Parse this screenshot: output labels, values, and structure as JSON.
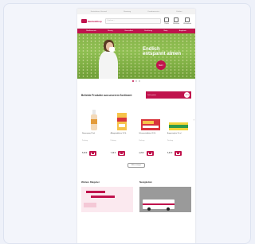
{
  "topstrip": [
    "Kostenloser Versand",
    "Beratung",
    "Kundenservice",
    "Filialen"
  ],
  "header": {
    "logo_text": "MedicaShop",
    "search_placeholder": "Suchen...",
    "icons": [
      {
        "name": "account-icon",
        "label": "Konto"
      },
      {
        "name": "wishlist-icon",
        "label": "Merkliste"
      },
      {
        "name": "cart-icon",
        "label": "Warenkorb"
      }
    ]
  },
  "nav": [
    "Medikamente",
    "Beauty",
    "Gesundheit",
    "Ernährung",
    "Baby",
    "Angebote"
  ],
  "hero": {
    "title": "Endlich entspannt atmen",
    "cta": "Mehr"
  },
  "products_section": {
    "title": "Beliebte Produkte aus unserem Sortiment",
    "promo_text": "Jetzt sparen",
    "promo_discount": "-20%",
    "products": [
      {
        "name": "Nasenspray 20 ml",
        "meta": "Packung",
        "price": "5,99 €"
      },
      {
        "name": "Allergietabletten 10 St.",
        "meta": "Packung",
        "price": "7,49 €"
      },
      {
        "name": "Schmerztabletten 20 St.",
        "meta": "Packung",
        "price": "4,29 €"
      },
      {
        "name": "Augentropfen 10 ml",
        "meta": "Packung",
        "price": "6,99 €"
      }
    ],
    "more_label": "Mehr anzeigen"
  },
  "bottom": {
    "ratgeber_title": "Weitere Ratgeber",
    "news_title": "Neuigkeiten"
  },
  "colors": {
    "brand": "#c0134d",
    "hero_green": "#86b34a"
  }
}
